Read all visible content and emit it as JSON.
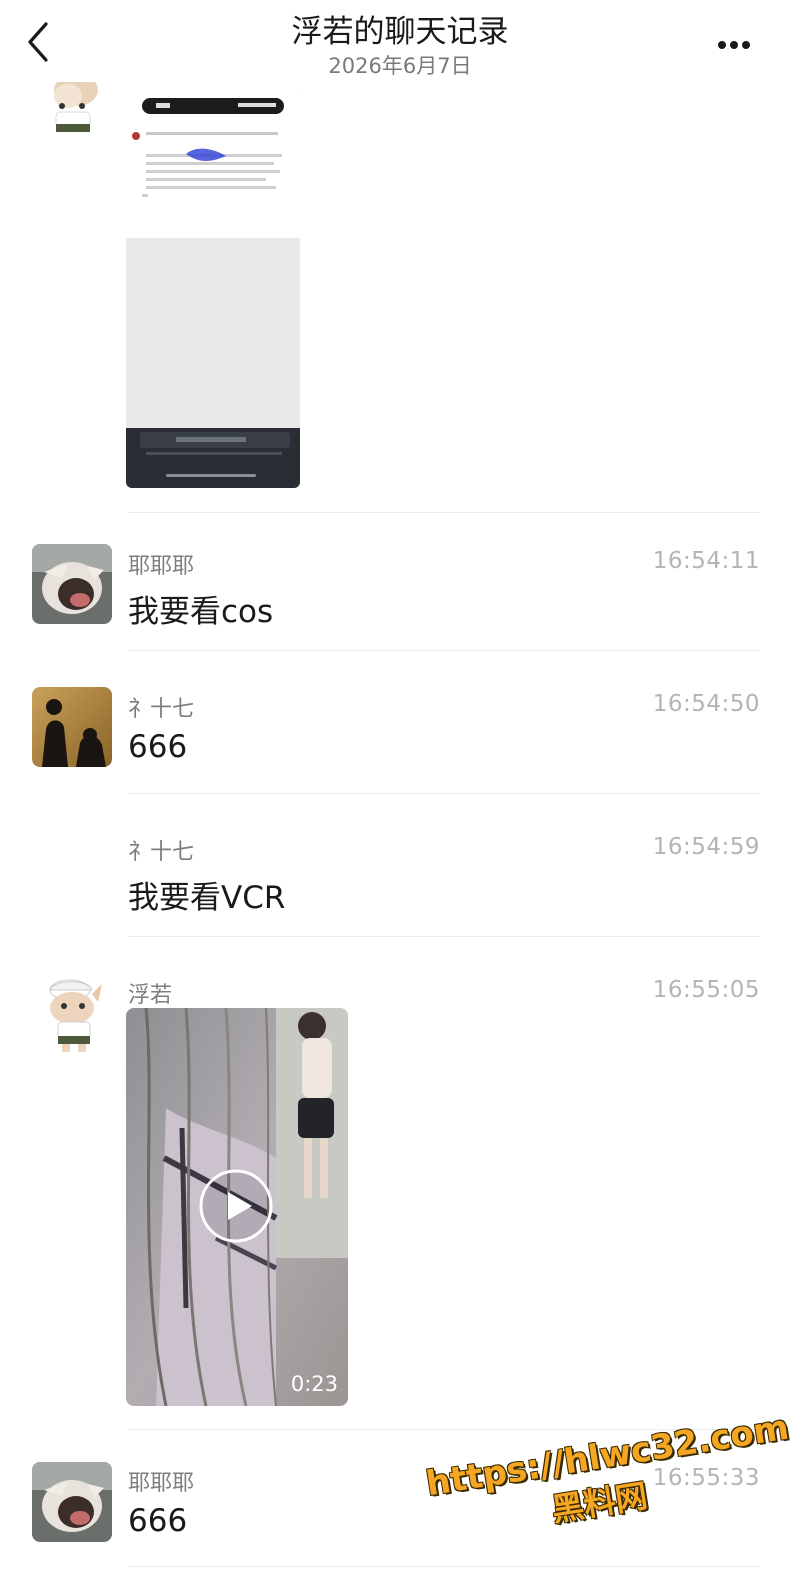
{
  "header": {
    "title": "浮若的聊天记录",
    "date": "2026年6月7日",
    "back_icon": "chevron-left-icon",
    "more_icon": "more-dots-icon"
  },
  "messages": [
    {
      "sender": "",
      "time": "",
      "type": "image"
    },
    {
      "sender": "耶耶耶",
      "time": "16:54:11",
      "text": "我要看cos"
    },
    {
      "sender": "礻十七",
      "time": "16:54:50",
      "text": "666"
    },
    {
      "sender": "礻十七",
      "time": "16:54:59",
      "text": "我要看VCR"
    },
    {
      "sender": "浮若",
      "time": "16:55:05",
      "type": "video",
      "duration": "0:23"
    },
    {
      "sender": "耶耶耶",
      "time": "16:55:33",
      "text": "666"
    }
  ],
  "watermark": {
    "url": "https://hlwc32.com",
    "name": "黑料网"
  },
  "colors": {
    "background": "#ffffff",
    "secondary_text": "#7d7d7d",
    "timestamp": "#b4b4b4",
    "watermark": "#f5a623"
  }
}
